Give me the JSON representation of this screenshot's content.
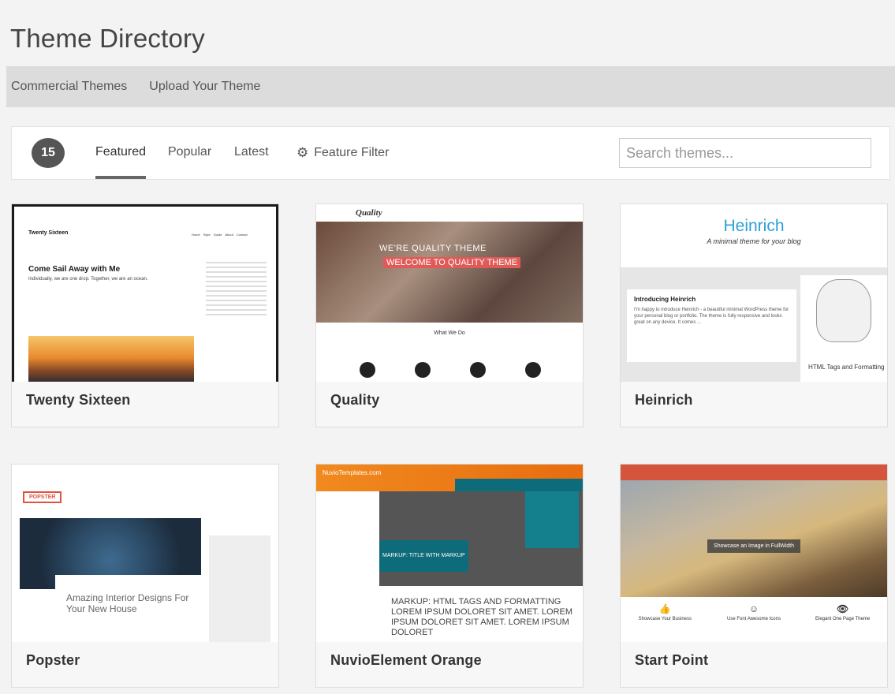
{
  "page": {
    "title": "Theme Directory"
  },
  "subnav": {
    "items": [
      "Commercial Themes",
      "Upload Your Theme"
    ]
  },
  "filters": {
    "count": "15",
    "tabs": [
      "Featured",
      "Popular",
      "Latest"
    ],
    "active_tab": "Featured",
    "feature_filter": "Feature Filter",
    "search_placeholder": "Search themes..."
  },
  "themes": [
    {
      "name": "Twenty Sixteen",
      "preview": {
        "brand": "Twenty Sixteen",
        "nav": "Home Style Guide About Contact",
        "post_title": "Come Sail Away with Me",
        "post_sub": "Individually, we are one drop. Together, we are an ocean."
      }
    },
    {
      "name": "Quality",
      "preview": {
        "logo": "Quality",
        "line1": "WE'RE QUALITY THEME",
        "line2": "WELCOME TO QUALITY THEME",
        "section": "What We Do"
      }
    },
    {
      "name": "Heinrich",
      "preview": {
        "title": "Heinrich",
        "tagline": "A minimal theme for your blog",
        "post_title": "Introducing Heinrich",
        "post_text": "I'm happy to introduce Heinrich - a beautiful minimal WordPress theme for your personal blog or portfolio. The theme is fully responsive and looks great on any device. It comes ...",
        "side_label": "HTML Tags and Formatting"
      }
    },
    {
      "name": "Popster",
      "preview": {
        "logo": "POPSTER",
        "box_text": "Amazing Interior Designs For Your New House"
      }
    },
    {
      "name": "NuvioElement Orange",
      "preview": {
        "brand": "NuvioTemplates.com",
        "teal_text": "MARKUP: TITLE WITH MARKUP",
        "headline": "MARKUP: HTML TAGS AND FORMATTING LOREM IPSUM DOLORET SIT AMET. LOREM IPSUM DOLORET SIT AMET. LOREM IPSUM DOLORET"
      }
    },
    {
      "name": "Start Point",
      "preview": {
        "caption": "Showcase an Image in FullWidth",
        "features": [
          "Showcase Your Business",
          "Use Font Awesome Icons",
          "Elegant One Page Theme"
        ]
      }
    }
  ]
}
